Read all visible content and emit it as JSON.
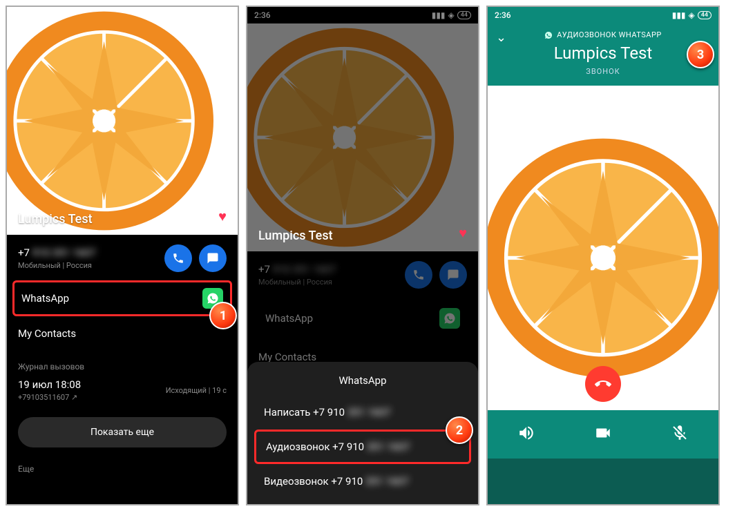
{
  "status": {
    "time": "2:36",
    "battery": "44"
  },
  "contact": {
    "name": "Lumpics Test",
    "phone_prefix": "+7 ",
    "phone_blurred": "910 351 1607",
    "phone_sub": "Мобильный  |  Россия"
  },
  "panel1": {
    "whatsapp_label": "WhatsApp",
    "my_contacts": "My Contacts",
    "history_label": "Журнал вызовов",
    "hist_date": "19 июл 18:08",
    "hist_num": "+79103511607 ↗",
    "hist_right": "Исходящий | 19 с  ",
    "show_more": "Показать еще",
    "more": "Еще"
  },
  "panel2": {
    "sheet_title": "WhatsApp",
    "opt1_prefix": "Написать +7 910 ",
    "opt2_prefix": "Аудиозвонок +7 910 ",
    "opt3_prefix": "Видеозвонок +7 910 ",
    "opt_blurred": "351 1607"
  },
  "panel3": {
    "sub": "АУДИОЗВОНОК WHATSAPP",
    "status": "ЗВОНОК"
  },
  "badges": {
    "b1": "1",
    "b2": "2",
    "b3": "3"
  }
}
